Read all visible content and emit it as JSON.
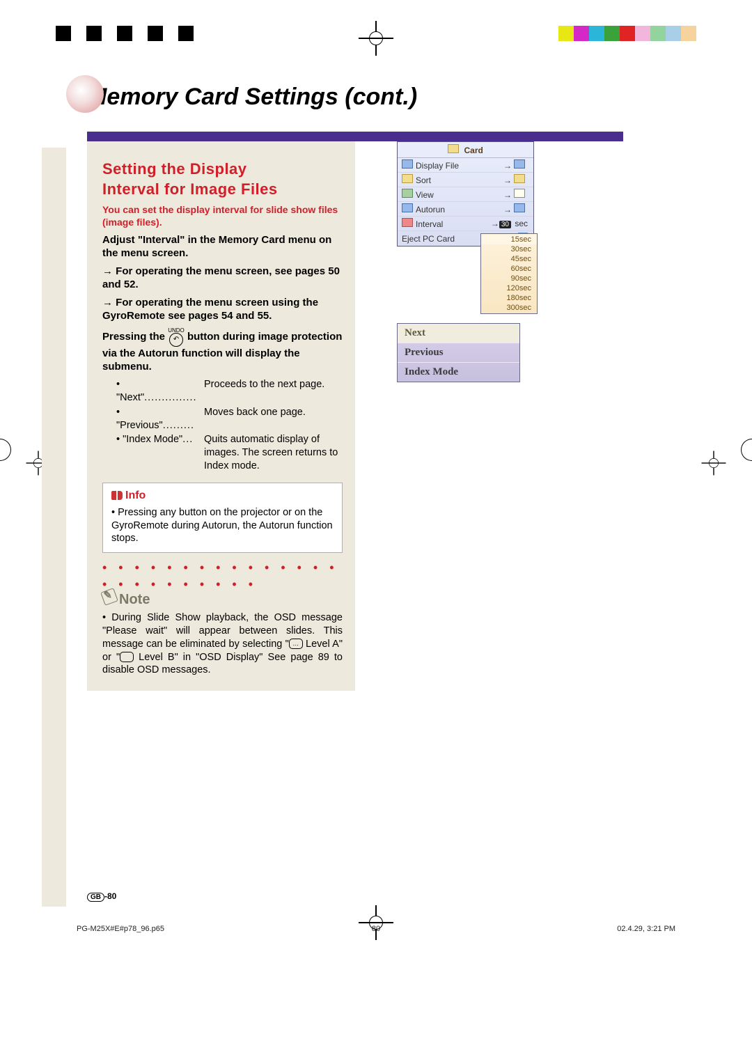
{
  "page_title": "Memory Card Settings (cont.)",
  "section_title_line1": "Setting the Display",
  "section_title_line2": "Interval for Image Files",
  "lead": "You can set the display interval for slide show files (image files).",
  "para1": "Adjust \"Interval\" in the Memory Card menu on the menu screen.",
  "para2": "→ For operating the menu screen, see pages 50 and 52.",
  "para3": "→ For operating the menu screen using the GyroRemote see pages 54 and 55.",
  "press_pre": "Pressing the ",
  "undo_label": "UNDO",
  "press_post": " button during image protection via the Autorun function will display the submenu.",
  "items": {
    "next": {
      "label": "\"Next\"",
      "dots": "...............",
      "desc": "Proceeds to the next page."
    },
    "prev": {
      "label": "\"Previous\"",
      "dots": ".........",
      "desc": "Moves back one page."
    },
    "index": {
      "label": "\"Index Mode\"",
      "dots": "...",
      "desc": "Quits automatic display of images. The screen returns to Index mode."
    }
  },
  "info_hdr": "Info",
  "info_body": "Pressing any button on the projector or on the GyroRemote during Autorun, the Autorun function stops.",
  "note_hdr": "Note",
  "note_body_a": "During Slide Show playback, the OSD message \"Please wait\" will appear between slides. This message can be eliminated by selecting \"",
  "note_lvl_a": "…",
  "note_body_b": " Level A\" or \"",
  "note_lvl_b": " ",
  "note_body_c": " Level B\" in \"OSD Display\" See page 89 to disable OSD messages.",
  "osd": {
    "title": "Card",
    "rows": [
      {
        "icon": "blue",
        "label": "Display File",
        "right": "→",
        "rico": "blue"
      },
      {
        "icon": "yel",
        "label": "Sort",
        "right": "→",
        "rico": "yel"
      },
      {
        "icon": "grn",
        "label": "View",
        "right": "→",
        "rico": "plain"
      },
      {
        "icon": "blue",
        "label": "Autorun",
        "right": "→",
        "rico": "blue"
      },
      {
        "icon": "red",
        "label": "Interval",
        "right": "→",
        "val": "30",
        "unit": "sec"
      },
      {
        "icon": "",
        "label": "Eject PC Card",
        "right": "",
        "eject": true
      }
    ]
  },
  "intervals": [
    "15sec",
    "30sec",
    "45sec",
    "60sec",
    "90sec",
    "120sec",
    "180sec",
    "300sec"
  ],
  "interval_selected": 0,
  "nav": [
    "Next",
    "Previous",
    "Index Mode"
  ],
  "page_number_prefix": "GB",
  "page_number": "-80",
  "footer_file": "PG-M25X#E#p78_96.p65",
  "footer_page": "80",
  "footer_time": "02.4.29, 3:21 PM",
  "colorbar_left": [
    "#000",
    "#fff",
    "#000",
    "#fff",
    "#000",
    "#fff",
    "#000",
    "#fff",
    "#000"
  ],
  "colorbar_right": [
    "#e7e713",
    "#d429c7",
    "#2ab5d9",
    "#3aa23a",
    "#e02323",
    "#f2b6dc",
    "#93d39e",
    "#a9cfe8",
    "#f6d29c"
  ]
}
